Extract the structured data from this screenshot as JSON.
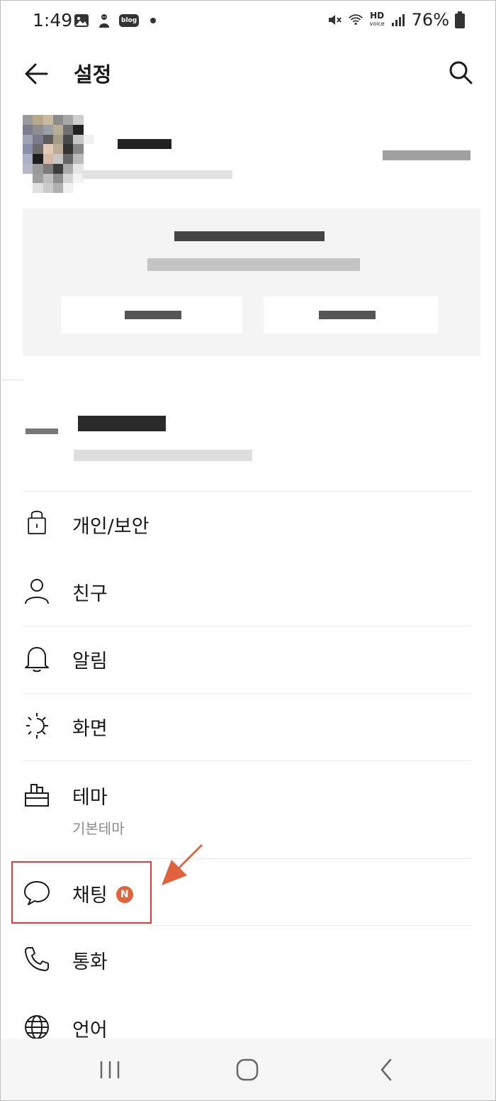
{
  "status_bar": {
    "time": "1:49",
    "blog_label": "blog",
    "hd_label": "HD",
    "voice_label": "voice",
    "battery": "76%"
  },
  "header": {
    "title": "설정"
  },
  "menu": {
    "items": [
      {
        "label": "개인/보안",
        "icon": "lock-icon"
      },
      {
        "label": "친구",
        "icon": "person-icon"
      },
      {
        "label": "알림",
        "icon": "bell-icon"
      },
      {
        "label": "화면",
        "icon": "display-brightness-icon"
      },
      {
        "label": "테마",
        "sublabel": "기본테마",
        "icon": "paint-brush-icon"
      },
      {
        "label": "채팅",
        "badge": "N",
        "icon": "chat-bubble-icon"
      },
      {
        "label": "통화",
        "icon": "phone-icon"
      },
      {
        "label": "언어",
        "icon": "globe-icon"
      }
    ]
  },
  "colors": {
    "badge": "#e0623f",
    "highlight_border": "#e03a3a",
    "arrow": "#e0623f",
    "card_bg": "#f4f4f4"
  }
}
